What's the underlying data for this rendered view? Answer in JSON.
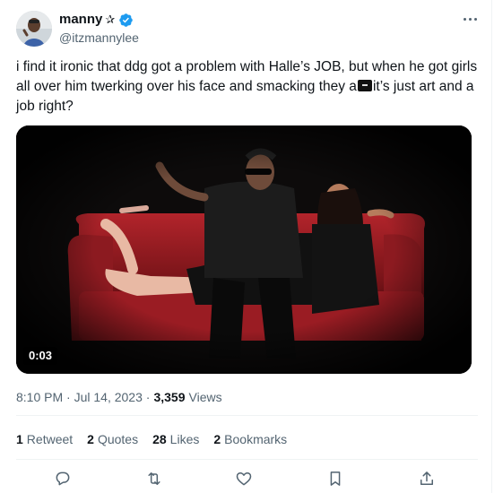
{
  "user": {
    "display_name": "manny",
    "name_emoji": "✰",
    "handle": "@itzmannylee",
    "verified": true
  },
  "tweet": {
    "text": "i find it ironic that ddg got a problem with Halle’s JOB, but when he got girls all over him twerking over his face and smacking they a",
    "text_after_emoji": "it’s just art and a job right?"
  },
  "media": {
    "duration": "0:03"
  },
  "meta": {
    "time": "8:10 PM",
    "date": "Jul 14, 2023",
    "views_count": "3,359",
    "views_label": "Views"
  },
  "stats": [
    {
      "count": "1",
      "label": "Retweet"
    },
    {
      "count": "2",
      "label": "Quotes"
    },
    {
      "count": "28",
      "label": "Likes"
    },
    {
      "count": "2",
      "label": "Bookmarks"
    }
  ],
  "icons": {
    "reply": "reply-icon",
    "retweet": "retweet-icon",
    "like": "heart-icon",
    "bookmark": "bookmark-icon",
    "share": "share-icon",
    "more": "more-icon",
    "verified": "verified-icon"
  },
  "colors": {
    "verified": "#1d9bf0",
    "secondary_text": "#536471",
    "primary_text": "#0f1419"
  }
}
